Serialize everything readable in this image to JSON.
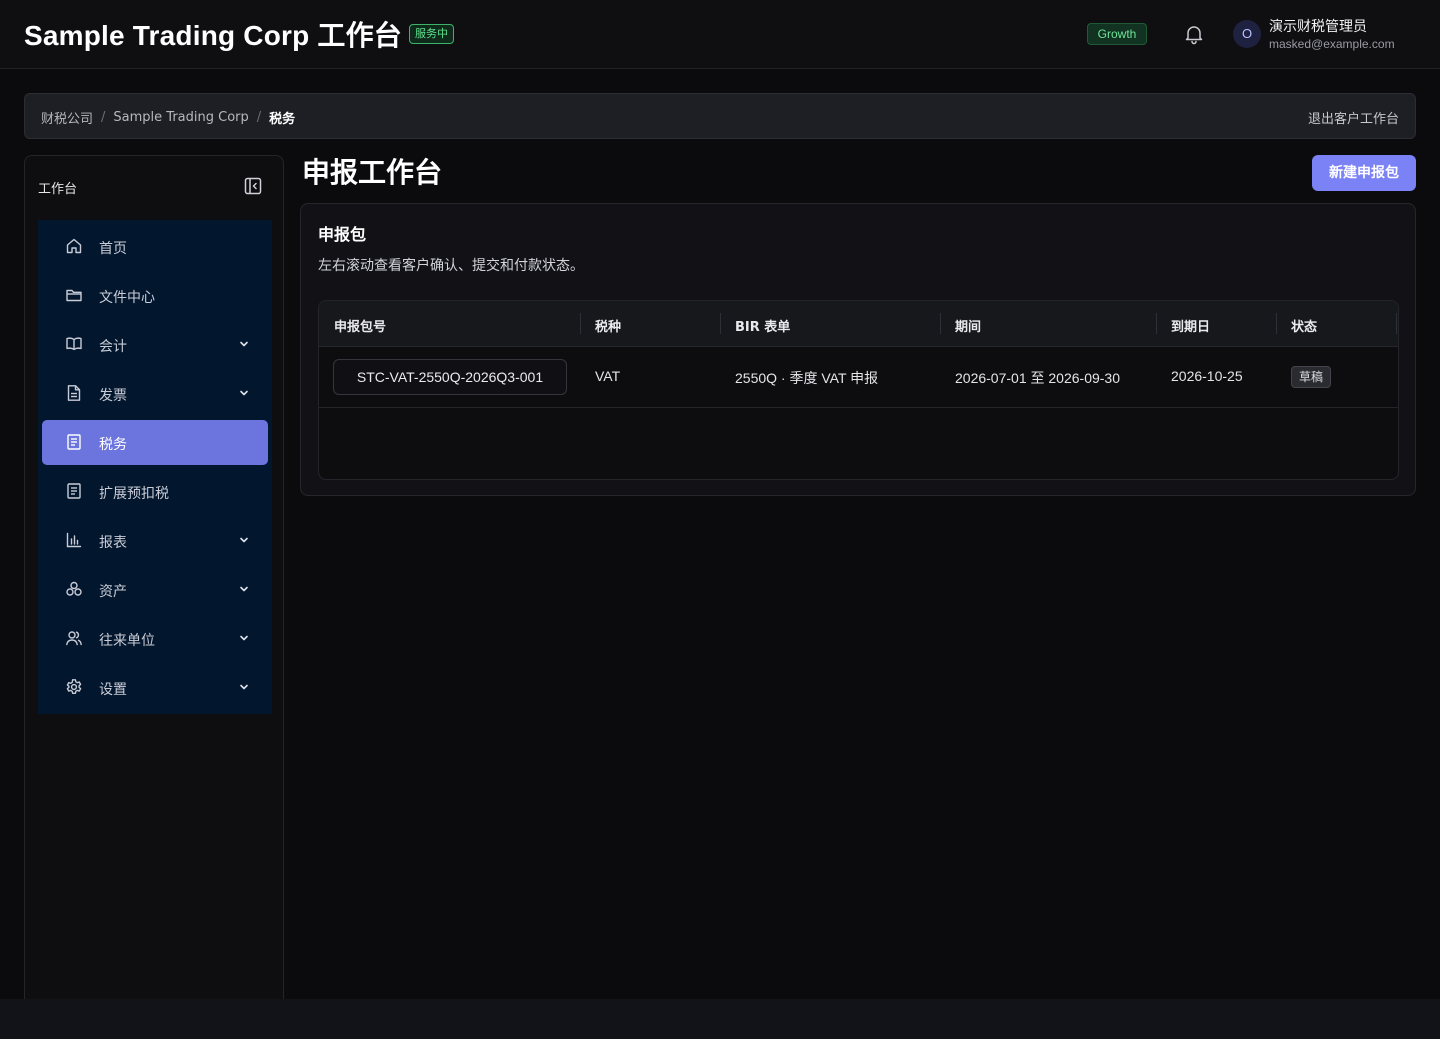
{
  "header": {
    "title": "Sample Trading Corp 工作台",
    "service_status": "服务中",
    "plan": "Growth",
    "user": {
      "avatar_initial": "O",
      "name": "演示财税管理员",
      "email": "masked@example.com"
    }
  },
  "breadcrumb": {
    "items": [
      "财税公司",
      "Sample Trading Corp",
      "税务"
    ],
    "separator": "/",
    "exit_label": "退出客户工作台"
  },
  "sidebar": {
    "heading": "工作台",
    "items": [
      {
        "label": "首页",
        "icon": "home-icon",
        "expandable": false,
        "active": false
      },
      {
        "label": "文件中心",
        "icon": "folder-icon",
        "expandable": false,
        "active": false
      },
      {
        "label": "会计",
        "icon": "book-icon",
        "expandable": true,
        "active": false
      },
      {
        "label": "发票",
        "icon": "document-icon",
        "expandable": true,
        "active": false
      },
      {
        "label": "税务",
        "icon": "tax-doc-icon",
        "expandable": false,
        "active": true
      },
      {
        "label": "扩展预扣税",
        "icon": "withholding-doc-icon",
        "expandable": false,
        "active": false
      },
      {
        "label": "报表",
        "icon": "bar-chart-icon",
        "expandable": true,
        "active": false
      },
      {
        "label": "资产",
        "icon": "assets-icon",
        "expandable": true,
        "active": false
      },
      {
        "label": "往来单位",
        "icon": "users-icon",
        "expandable": true,
        "active": false
      },
      {
        "label": "设置",
        "icon": "gear-icon",
        "expandable": true,
        "active": false
      }
    ]
  },
  "main": {
    "title": "申报工作台",
    "new_button": "新建申报包",
    "card": {
      "title": "申报包",
      "description": "左右滚动查看客户确认、提交和付款状态。",
      "table": {
        "columns": [
          "申报包号",
          "税种",
          "BIR 表单",
          "期间",
          "到期日",
          "状态"
        ],
        "rows": [
          {
            "package_id": "STC-VAT-2550Q-2026Q3-001",
            "tax_type": "VAT",
            "bir_form": "2550Q · 季度 VAT 申报",
            "period": "2026-07-01 至 2026-09-30",
            "due_date": "2026-10-25",
            "status": "草稿"
          }
        ]
      }
    }
  },
  "colors": {
    "accent": "#7b82f5",
    "active_nav": "#6c75dd",
    "nav_bg": "#02162e",
    "success": "#5fe08f"
  }
}
